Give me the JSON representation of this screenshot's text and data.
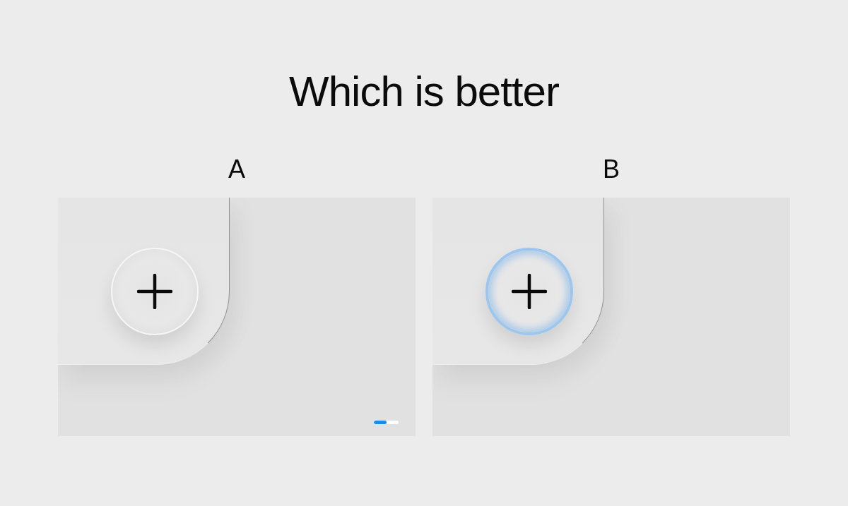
{
  "title": "Which is better",
  "options": [
    {
      "label": "A",
      "kind": "plain",
      "progress": {
        "level": 0.5
      }
    },
    {
      "label": "B",
      "kind": "blue-ring"
    }
  ]
}
